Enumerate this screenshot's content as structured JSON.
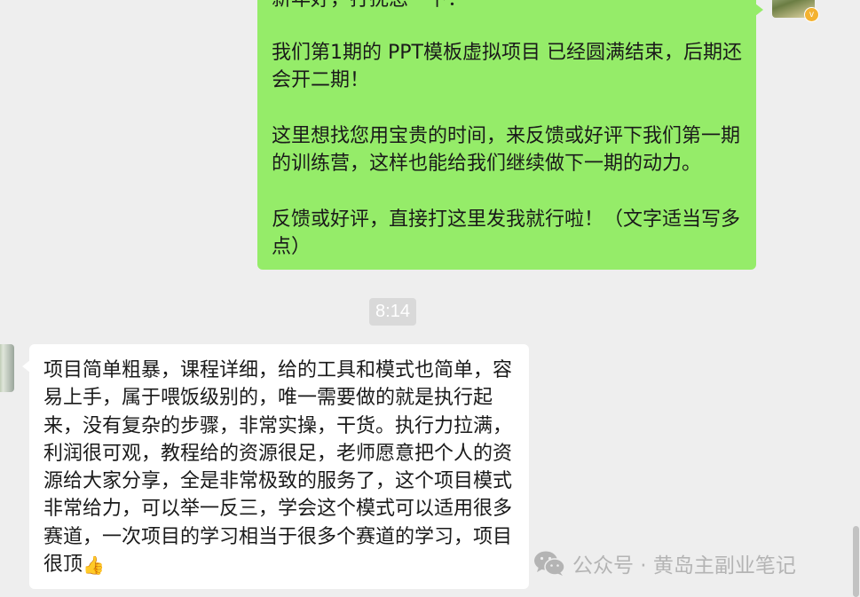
{
  "conversation": {
    "outgoing_message": {
      "lines": [
        "新年好，打扰您一下：",
        "我们第1期的 PPT模板虚拟项目 已经圆满结束，后期还会开二期！",
        "这里想找您用宝贵的时间，来反馈或好评下我们第一期的训练营，这样也能给我们继续做下一期的动力。",
        "反馈或好评，直接打这里发我就行啦！（文字适当写多点）"
      ]
    },
    "self_avatar_badge": "v",
    "timestamp": "8:14",
    "incoming_message": {
      "text": "项目简单粗暴，课程详细，给的工具和模式也简单，容易上手，属于喂饭级别的，唯一需要做的就是执行起来，没有复杂的步骤，非常实操，干货。执行力拉满，利润很可观，教程给的资源很足，老师愿意把个人的资源给大家分享，全是非常极致的服务了，这个项目模式非常给力，可以举一反三，学会这个模式可以适用很多赛道，一次项目的学习相当于很多个赛道的学习，项目很顶",
      "emoji": "👍"
    }
  },
  "watermark": {
    "text": "公众号 · 黄岛主副业笔记",
    "icon": "wechat-icon"
  },
  "colors": {
    "background": "#eeeeee",
    "outgoing_bubble": "#95ec69",
    "incoming_bubble": "#ffffff",
    "timestamp_bg": "#d9d9d9"
  }
}
